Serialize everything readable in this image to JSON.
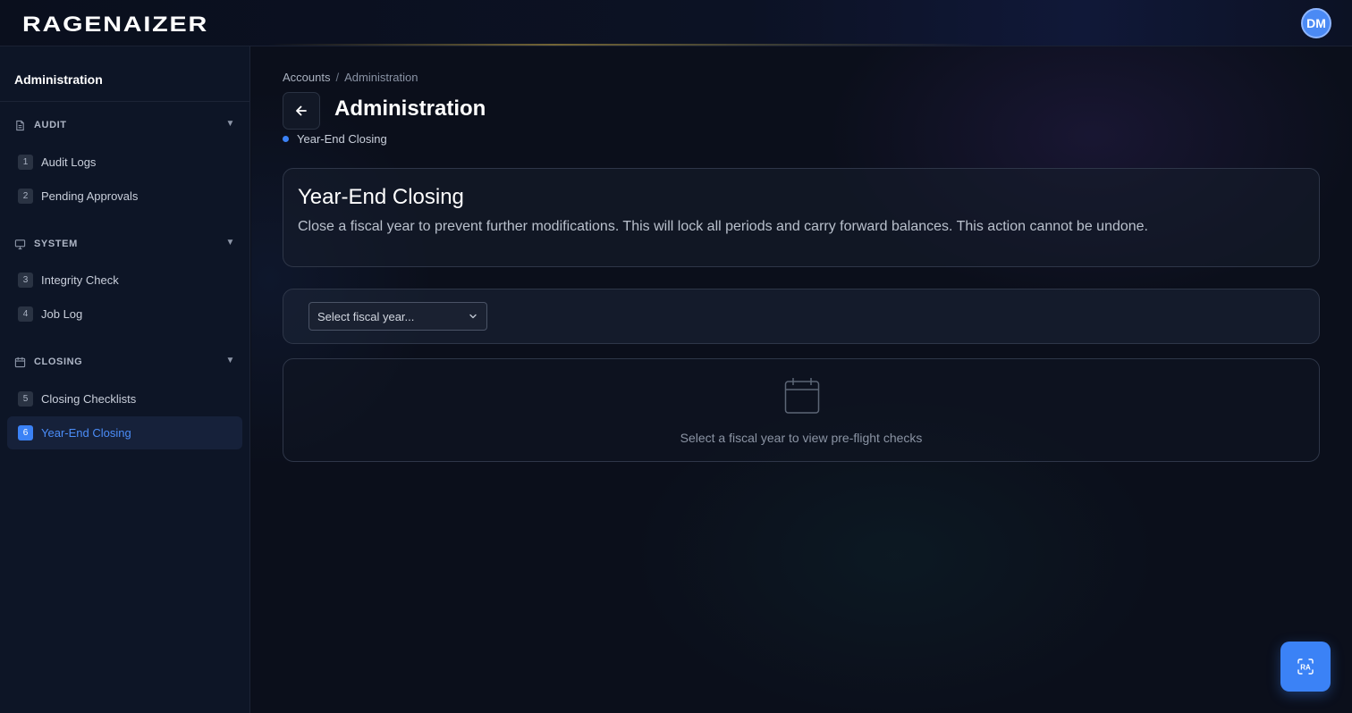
{
  "header": {
    "logo_text": "RAGENAIZER",
    "avatar_initials": "DM"
  },
  "sidebar": {
    "title": "Administration",
    "sections": [
      {
        "label": "AUDIT",
        "icon": "document-icon",
        "items": [
          {
            "num": "1",
            "label": "Audit Logs"
          },
          {
            "num": "2",
            "label": "Pending Approvals"
          }
        ]
      },
      {
        "label": "SYSTEM",
        "icon": "monitor-icon",
        "items": [
          {
            "num": "3",
            "label": "Integrity Check"
          },
          {
            "num": "4",
            "label": "Job Log"
          }
        ]
      },
      {
        "label": "CLOSING",
        "icon": "calendar-icon",
        "items": [
          {
            "num": "5",
            "label": "Closing Checklists"
          },
          {
            "num": "6",
            "label": "Year-End Closing",
            "active": true
          }
        ]
      }
    ]
  },
  "breadcrumb": {
    "items": [
      "Accounts",
      "Administration"
    ],
    "separator": "/"
  },
  "page": {
    "title": "Administration",
    "subpage": "Year-End Closing"
  },
  "info_card": {
    "title": "Year-End Closing",
    "description": "Close a fiscal year to prevent further modifications. This will lock all periods and carry forward balances. This action cannot be undone."
  },
  "filter": {
    "select_placeholder": "Select fiscal year..."
  },
  "empty_state": {
    "icon": "calendar-icon",
    "message": "Select a fiscal year to view pre-flight checks"
  },
  "fab": {
    "icon": "assistant-icon",
    "badge_text": "RA"
  },
  "colors": {
    "accent": "#3b82f6",
    "background": "#0b0f1b",
    "sidebar": "#0d1526"
  }
}
